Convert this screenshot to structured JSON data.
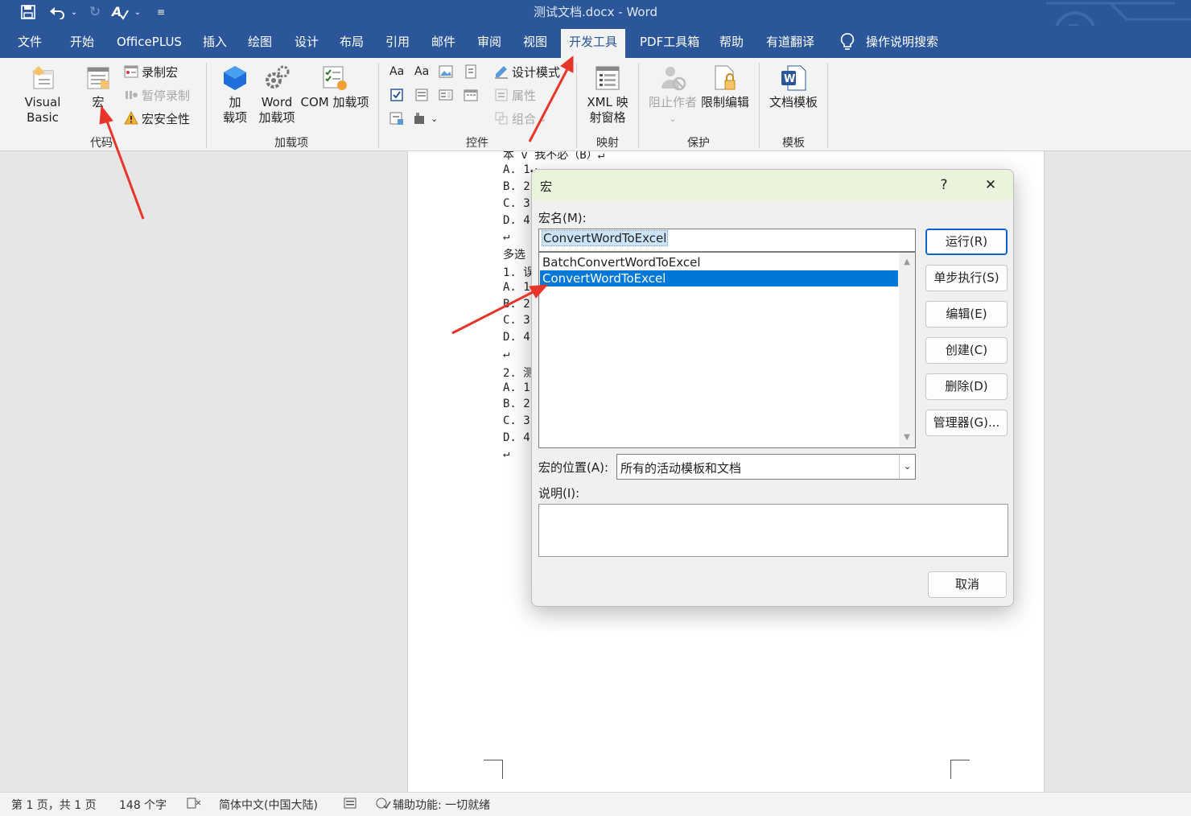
{
  "window": {
    "title": "测试文档.docx  -  Word",
    "quick_access": [
      "save-icon",
      "undo-icon",
      "redo-icon",
      "spelling-icon",
      "customize-icon"
    ]
  },
  "tabs": [
    {
      "label": "文件"
    },
    {
      "label": "开始"
    },
    {
      "label": "OfficePLUS"
    },
    {
      "label": "插入"
    },
    {
      "label": "绘图"
    },
    {
      "label": "设计"
    },
    {
      "label": "布局"
    },
    {
      "label": "引用"
    },
    {
      "label": "邮件"
    },
    {
      "label": "审阅"
    },
    {
      "label": "视图"
    },
    {
      "label": "开发工具",
      "active": true
    },
    {
      "label": "PDF工具箱"
    },
    {
      "label": "帮助"
    },
    {
      "label": "有道翻译"
    },
    {
      "label": "操作说明搜索"
    }
  ],
  "ribbon": {
    "code": {
      "label": "代码",
      "visual_basic": "Visual Basic",
      "macros": "宏",
      "record_macro": "录制宏",
      "pause_recording": "暂停录制",
      "macro_security": "宏安全性"
    },
    "addins": {
      "label": "加载项",
      "addins_line1": "加",
      "addins_line2": "载项",
      "word_addins_line1": "Word",
      "word_addins_line2": "加载项",
      "com_addins": "COM 加载项"
    },
    "controls": {
      "label": "控件",
      "design_mode": "设计模式",
      "properties": "属性",
      "group": "组合"
    },
    "mapping": {
      "label": "映射",
      "xml_line1": "XML 映",
      "xml_line2": "射窗格"
    },
    "protect": {
      "label": "保护",
      "block_authors": "阻止作者",
      "restrict_editing": "限制编辑"
    },
    "templates": {
      "label": "模板",
      "document_template": "文档模板"
    }
  },
  "document": {
    "lines": [
      "本 v 我不必（B）↵",
      "A. 1↵",
      "B. 2",
      "C. 3",
      "D. 4",
      "↵",
      "多选",
      "1. 误",
      "A. 1",
      "B. 2",
      "C. 3",
      "D. 4",
      "↵",
      "2. 测",
      "A. 1",
      "B. 2",
      "C. 3",
      "D. 4",
      "↵"
    ]
  },
  "dialog": {
    "title": "宏",
    "help": "?",
    "close": "✕",
    "macro_name_label": "宏名(M):",
    "macro_name_value": "ConvertWordToExcel",
    "macros": [
      {
        "name": "BatchConvertWordToExcel",
        "selected": false
      },
      {
        "name": "ConvertWordToExcel",
        "selected": true
      }
    ],
    "buttons": {
      "run": "运行(R)",
      "step_into": "单步执行(S)",
      "edit": "编辑(E)",
      "create": "创建(C)",
      "delete": "删除(D)",
      "organizer": "管理器(G)...",
      "cancel": "取消"
    },
    "location_label": "宏的位置(A):",
    "location_value": "所有的活动模板和文档",
    "description_label": "说明(I):",
    "description_value": ""
  },
  "status": {
    "page": "第 1 页，共 1 页",
    "words": "148 个字",
    "language": "简体中文(中国大陆)",
    "accessibility": "辅助功能: 一切就绪"
  },
  "colors": {
    "brand": "#2b579a",
    "selection": "#0078d7",
    "arrow": "#e8352a",
    "dialog_title": "#eaf4dd"
  }
}
